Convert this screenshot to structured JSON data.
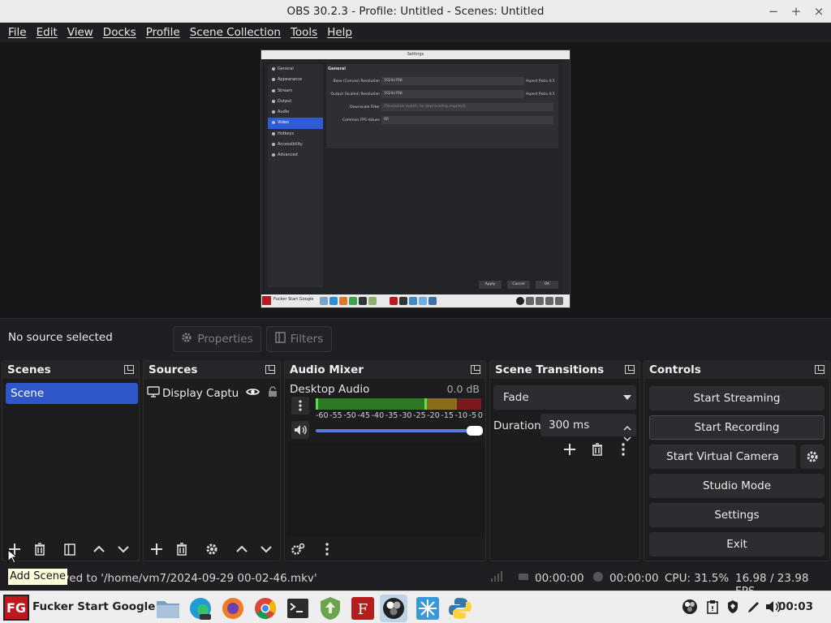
{
  "window": {
    "title": "OBS 30.2.3 - Profile: Untitled - Scenes: Untitled",
    "min_label": "−",
    "max_label": "+",
    "close_label": "×"
  },
  "menu": [
    "File",
    "Edit",
    "View",
    "Docks",
    "Profile",
    "Scene Collection",
    "Tools",
    "Help"
  ],
  "preview": {
    "window_title": "Settings",
    "sidebar": [
      "General",
      "Appearance",
      "Stream",
      "Output",
      "Audio",
      "Video",
      "Hotkeys",
      "Accessibility",
      "Advanced"
    ],
    "selected_index": 5,
    "section": "General",
    "rows": [
      {
        "label": "Base (Canvas) Resolution",
        "value": "1024x768",
        "extra": "Aspect Ratio 4:3"
      },
      {
        "label": "Output (Scaled) Resolution",
        "value": "1024x768",
        "extra": "Aspect Ratio 4:3"
      },
      {
        "label": "Downscale Filter",
        "value": "(Resolution match, no downscaling required)",
        "extra": ""
      },
      {
        "label": "Common FPS Values",
        "value": "60",
        "extra": ""
      }
    ],
    "buttons": [
      "Apply",
      "Cancel",
      "OK"
    ],
    "taskbar_brand": "Fucker Start Google"
  },
  "source_toolbar": {
    "no_source": "No source selected",
    "properties": "Properties",
    "filters": "Filters"
  },
  "scenes": {
    "title": "Scenes",
    "items": [
      "Scene"
    ]
  },
  "sources": {
    "title": "Sources",
    "items": [
      "Display Captu"
    ]
  },
  "mixer": {
    "title": "Audio Mixer",
    "track": {
      "name": "Desktop Audio",
      "db": "0.0 dB",
      "volume": 1.0
    },
    "ticks": [
      "-60",
      "-55",
      "-50",
      "-45",
      "-40",
      "-35",
      "-30",
      "-25",
      "-20",
      "-15",
      "-10",
      "-5",
      "0"
    ]
  },
  "transitions": {
    "title": "Scene Transitions",
    "selected": "Fade",
    "duration_label": "Duration",
    "duration_value": "300 ms"
  },
  "controls": {
    "title": "Controls",
    "start_streaming": "Start Streaming",
    "start_recording": "Start Recording",
    "start_virtual_camera": "Start Virtual Camera",
    "studio_mode": "Studio Mode",
    "settings": "Settings",
    "exit": "Exit"
  },
  "status": {
    "message": "aved to '/home/vm7/2024-09-29 00-02-46.mkv'",
    "tooltip": "Add Scene",
    "stream_time": "00:00:00",
    "rec_time": "00:00:00",
    "cpu": "CPU: 31.5%",
    "fps": "16.98 / 23.98 FPS"
  },
  "taskbar": {
    "logo_text": "FG",
    "brand": "Fucker Start Google",
    "clock": "00:03",
    "apps": [
      "file-manager",
      "edge-dev",
      "firefox",
      "chrome",
      "terminal",
      "updater",
      "font-viewer",
      "obs",
      "network",
      "python"
    ]
  },
  "colors": {
    "accent": "#2f57c9",
    "background": "#1e1e1e",
    "panel": "#1d1d20",
    "taskbar": "#eeeeee"
  }
}
